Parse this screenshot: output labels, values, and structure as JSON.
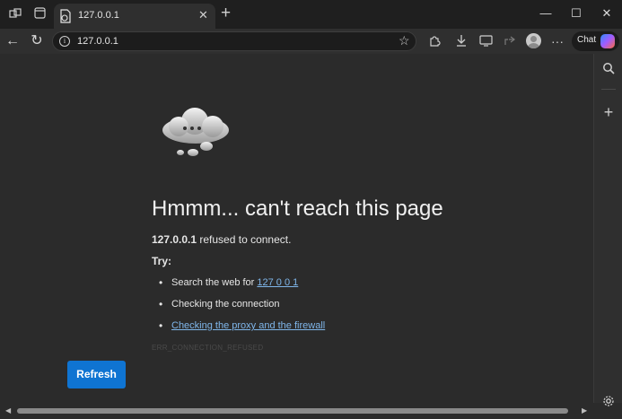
{
  "tab": {
    "title": "127.0.0.1",
    "close_icon": "close-icon"
  },
  "address_bar": {
    "url": "127.0.0.1"
  },
  "toolbar": {
    "chat_label": "Chat"
  },
  "error_page": {
    "headline": "Hmmm... can't reach this page",
    "host": "127.0.0.1",
    "message_tail": " refused to connect.",
    "try_label": "Try:",
    "suggestions": [
      {
        "prefix": "Search the web for ",
        "link": "127 0 0 1"
      },
      {
        "text": "Checking the connection"
      },
      {
        "link": "Checking the proxy and the firewall"
      }
    ],
    "error_code": "ERR_CONNECTION_REFUSED",
    "refresh_label": "Refresh"
  },
  "colors": {
    "accent": "#0f74d2",
    "link": "#7fb6ea",
    "background": "#2b2b2b"
  }
}
